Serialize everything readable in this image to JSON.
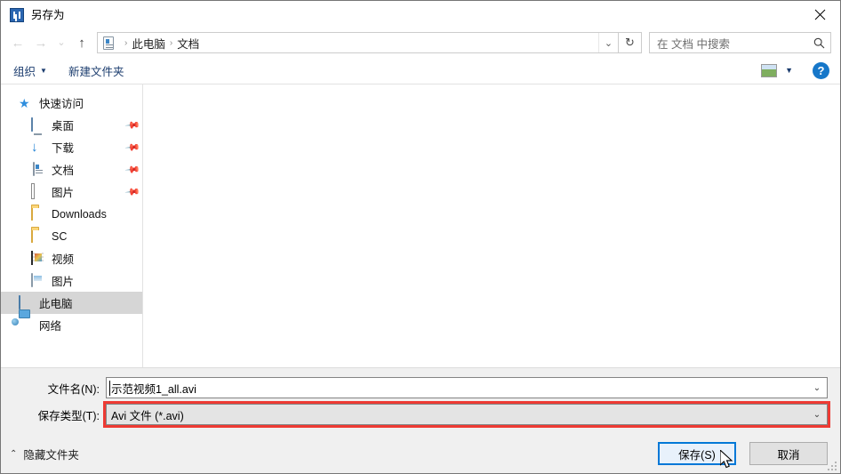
{
  "window": {
    "title": "另存为",
    "icon": "app-icon",
    "close_label": "×"
  },
  "nav": {
    "back": "←",
    "forward": "→",
    "recent": "⌄",
    "up": "↑",
    "refresh": "↻",
    "breadcrumb": {
      "icon": "documents-icon",
      "separator": "›",
      "items": [
        "此电脑",
        "文档"
      ]
    },
    "address_chevron": "⌄"
  },
  "search": {
    "placeholder": "在 文档 中搜索",
    "icon": "search-icon"
  },
  "toolbar": {
    "organize_label": "组织",
    "organize_caret": "▼",
    "new_folder_label": "新建文件夹",
    "view_icon": "view-mode-icon",
    "view_caret": "▼",
    "help_label": "?"
  },
  "sidebar": {
    "groups": [
      {
        "name": "快速访问",
        "icon": "star-pin-icon",
        "indent": "root",
        "pinned": false,
        "selected": false
      },
      {
        "name": "桌面",
        "icon": "desktop-icon",
        "indent": "child",
        "pinned": true,
        "selected": false
      },
      {
        "name": "下载",
        "icon": "downloads-icon",
        "indent": "child",
        "pinned": true,
        "selected": false
      },
      {
        "name": "文档",
        "icon": "documents-icon",
        "indent": "child",
        "pinned": true,
        "selected": false
      },
      {
        "name": "图片",
        "icon": "pictures-icon",
        "indent": "child",
        "pinned": true,
        "selected": false
      },
      {
        "name": "Downloads",
        "icon": "folder-icon",
        "indent": "child",
        "pinned": false,
        "selected": false
      },
      {
        "name": "SC",
        "icon": "folder-icon",
        "indent": "child",
        "pinned": false,
        "selected": false
      },
      {
        "name": "视频",
        "icon": "videos-icon",
        "indent": "child",
        "pinned": false,
        "selected": false
      },
      {
        "name": "图片",
        "icon": "pictures-library-icon",
        "indent": "child",
        "pinned": false,
        "selected": false
      },
      {
        "name": "此电脑",
        "icon": "this-pc-icon",
        "indent": "root",
        "pinned": false,
        "selected": true
      },
      {
        "name": "网络",
        "icon": "network-icon",
        "indent": "root",
        "pinned": false,
        "selected": false
      }
    ]
  },
  "fields": {
    "filename": {
      "label": "文件名(N):",
      "value": "示范视频1_all.avi",
      "chevron": "⌄"
    },
    "filetype": {
      "label": "保存类型(T):",
      "value": "Avi 文件 (*.avi)",
      "chevron": "⌄",
      "highlight_color": "#ee3a33"
    }
  },
  "footer": {
    "hide_folders_label": "隐藏文件夹",
    "hide_folders_caret": "⌃",
    "save_label": "保存(S)",
    "cancel_label": "取消"
  },
  "colors": {
    "accent": "#0078d7",
    "highlight_red": "#ee3a33",
    "chrome_bg": "#f0f0f0",
    "selected_row": "#d6d6d6"
  }
}
